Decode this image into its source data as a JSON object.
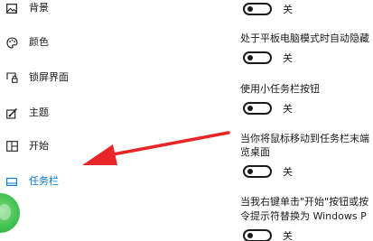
{
  "sidebar": {
    "items": [
      {
        "label": "背景",
        "icon": "picture-icon"
      },
      {
        "label": "颜色",
        "icon": "palette-icon"
      },
      {
        "label": "锁屏界面",
        "icon": "lock-screen-icon"
      },
      {
        "label": "主题",
        "icon": "theme-brush-icon"
      },
      {
        "label": "开始",
        "icon": "start-menu-icon"
      },
      {
        "label": "任务栏",
        "icon": "taskbar-icon",
        "active": true
      }
    ]
  },
  "settings": {
    "toggle1_state": "关",
    "tablet_autohide_text": "处于平板电脑模式时自动隐藏",
    "toggle2_state": "关",
    "small_buttons_text": "使用小任务栏按钮",
    "toggle3_state": "关",
    "peek_text_line1": "当你将鼠标移动到任务栏末端",
    "peek_text_line2": "览桌面",
    "toggle4_state": "关",
    "powershell_text_line1": "当我右键单击\"开始\"按钮或按",
    "powershell_text_line2": "令提示符替换为 Windows P",
    "toggle5_state": "关"
  },
  "colors": {
    "accent": "#0078d7",
    "arrow": "#e8262a"
  }
}
